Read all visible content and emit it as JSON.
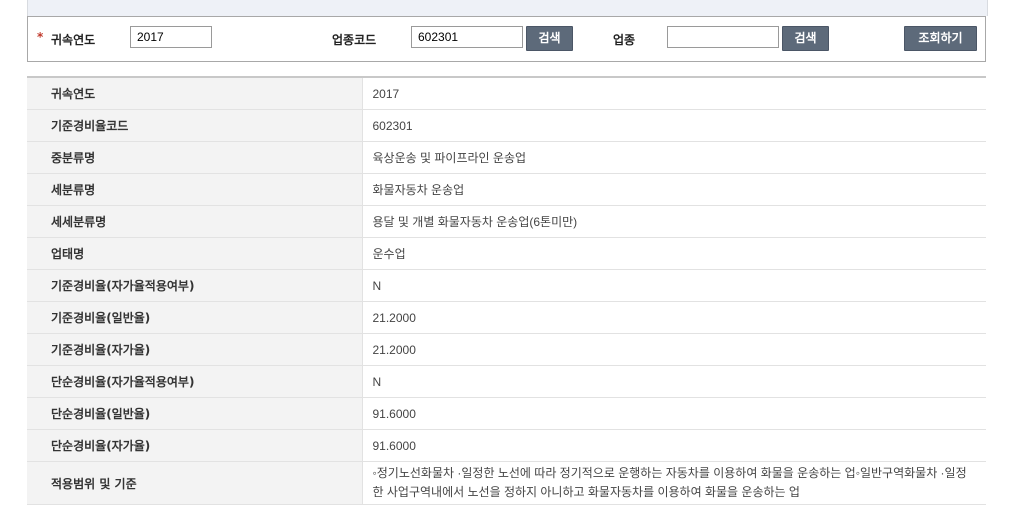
{
  "search": {
    "required_mark": "*",
    "year_label": "귀속연도",
    "year_value": "2017",
    "code_label": "업종코드",
    "code_value": "602301",
    "code_search_btn": "검색",
    "industry_label": "업종",
    "industry_value": "",
    "industry_search_btn": "검색",
    "query_btn": "조회하기"
  },
  "rows": [
    {
      "label": "귀속연도",
      "value": "2017"
    },
    {
      "label": "기준경비율코드",
      "value": "602301"
    },
    {
      "label": "중분류명",
      "value": "육상운송 및 파이프라인 운송업"
    },
    {
      "label": "세분류명",
      "value": "화물자동차 운송업"
    },
    {
      "label": "세세분류명",
      "value": "용달 및 개별 화물자동차 운송업(6톤미만)"
    },
    {
      "label": "업태명",
      "value": "운수업"
    },
    {
      "label": "기준경비율(자가율적용여부)",
      "value": "N"
    },
    {
      "label": "기준경비율(일반율)",
      "value": "21.2000"
    },
    {
      "label": "기준경비율(자가율)",
      "value": "21.2000"
    },
    {
      "label": "단순경비율(자가율적용여부)",
      "value": "N"
    },
    {
      "label": "단순경비율(일반율)",
      "value": "91.6000"
    },
    {
      "label": "단순경비율(자가율)",
      "value": "91.6000"
    },
    {
      "label": "적용범위 및 기준",
      "value": "◦정기노선화물차 ·일정한 노선에 따라 정기적으로 운행하는 자동차를 이용하여 화물을 운송하는 업◦일반구역화물차 ·일정한 사업구역내에서 노선을 정하지 아니하고 화물자동차를 이용하여 화물을 운송하는 업"
    }
  ]
}
